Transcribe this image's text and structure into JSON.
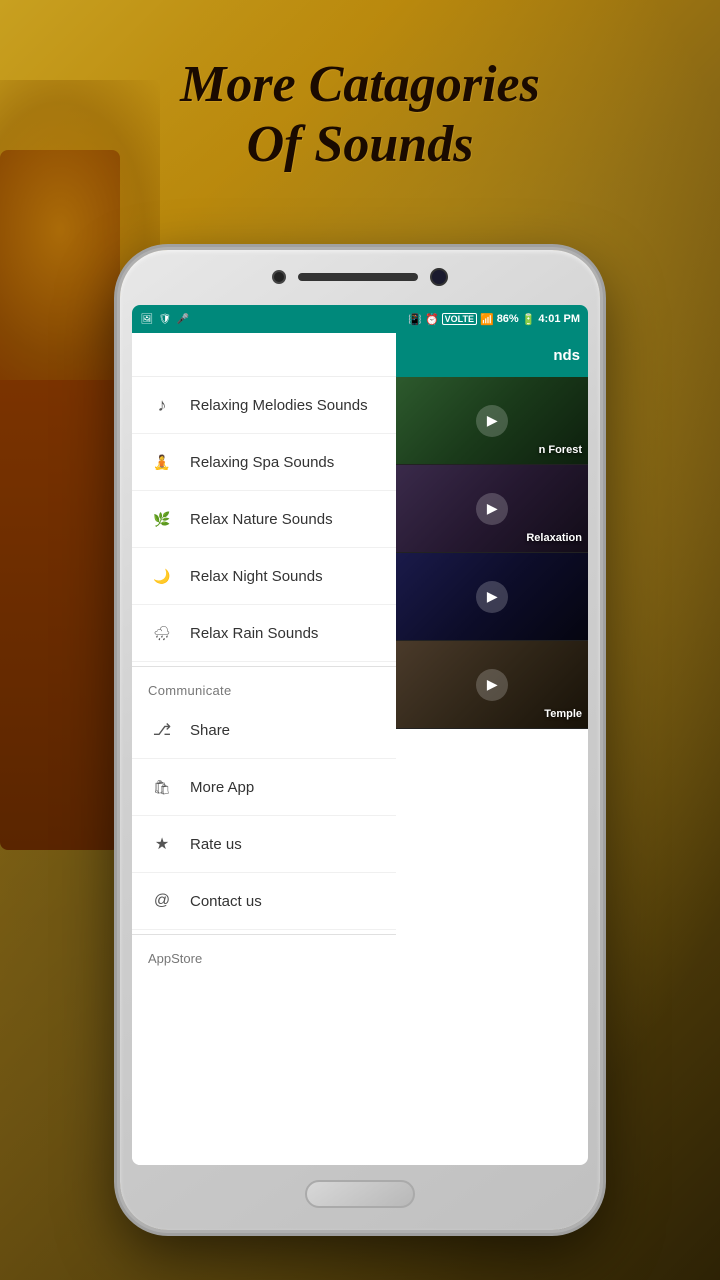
{
  "page": {
    "title_line1": "More Catagories",
    "title_line2": "Of Sounds"
  },
  "status_bar": {
    "battery": "86%",
    "time": "4:01 PM",
    "battery_icon": "🔋",
    "signal": "VOLTE"
  },
  "drawer": {
    "items": [
      {
        "id": "relaxing-melodies",
        "icon": "♪",
        "label": "Relaxing Melodies Sounds"
      },
      {
        "id": "relaxing-spa",
        "icon": "🧘",
        "label": "Relaxing Spa Sounds"
      },
      {
        "id": "relax-nature",
        "icon": "🌿",
        "label": "Relax Nature Sounds"
      },
      {
        "id": "relax-night",
        "icon": "🌙",
        "label": "Relax Night Sounds"
      },
      {
        "id": "relax-rain",
        "icon": "🌧",
        "label": "Relax Rain Sounds"
      }
    ],
    "communicate_label": "Communicate",
    "communicate_items": [
      {
        "id": "share",
        "icon": "≮",
        "label": "Share"
      },
      {
        "id": "more-app",
        "icon": "🛍",
        "label": "More App"
      },
      {
        "id": "rate-us",
        "icon": "★",
        "label": "Rate us"
      },
      {
        "id": "contact-us",
        "icon": "@",
        "label": "Contact us"
      }
    ],
    "appstore_label": "AppStore"
  },
  "right_panel": {
    "header": "nds",
    "items": [
      {
        "id": "forest",
        "label": "n Forest",
        "type": "forest"
      },
      {
        "id": "relax2",
        "label": "Relaxation",
        "type": "relax"
      },
      {
        "id": "temple",
        "label": "Temple",
        "type": "temple"
      }
    ]
  }
}
